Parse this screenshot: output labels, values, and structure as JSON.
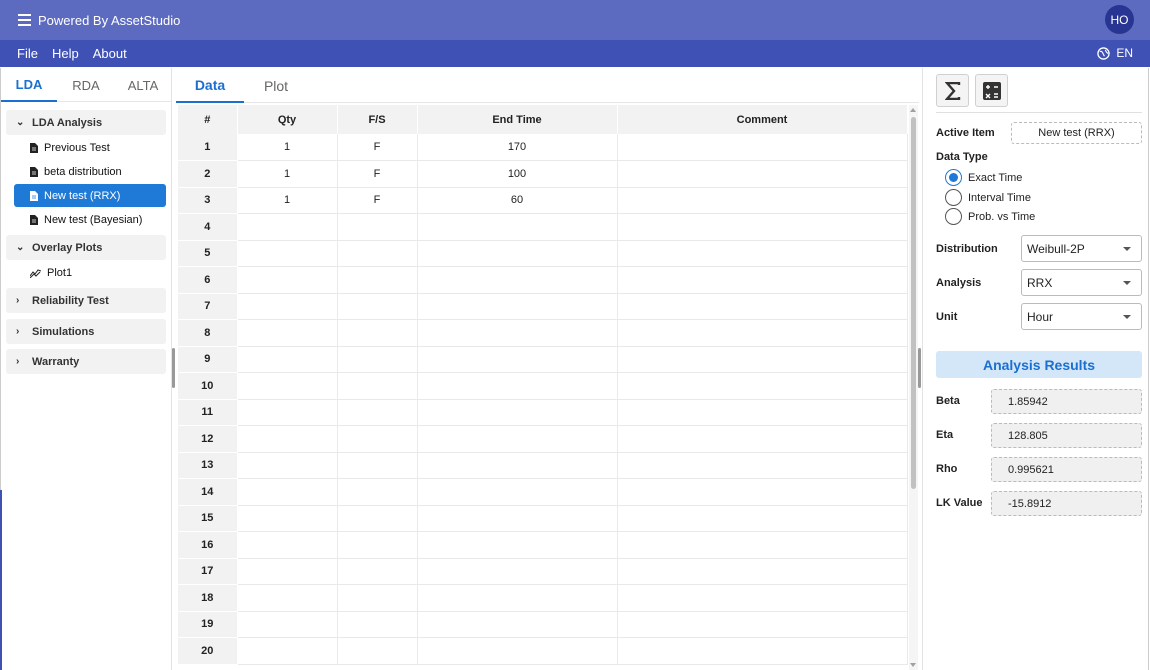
{
  "titlebar": {
    "title": "Powered By AssetStudio",
    "avatar": "HO"
  },
  "menu": {
    "file": "File",
    "help": "Help",
    "about": "About",
    "language": "EN"
  },
  "left_tabs": {
    "lda": "LDA",
    "rda": "RDA",
    "alta": "ALTA"
  },
  "tree": {
    "lda_analysis": "LDA Analysis",
    "items": [
      "Previous Test",
      "beta distribution",
      "New test (RRX)",
      "New test (Bayesian)"
    ],
    "overlay_plots": "Overlay Plots",
    "plot1": "Plot1",
    "reliability_test": "Reliability Test",
    "simulations": "Simulations",
    "warranty": "Warranty"
  },
  "center_tabs": {
    "data": "Data",
    "plot": "Plot"
  },
  "table": {
    "headers": [
      "#",
      "Qty",
      "F/S",
      "End Time",
      "Comment"
    ],
    "rows": [
      [
        "1",
        "1",
        "F",
        "170",
        ""
      ],
      [
        "2",
        "1",
        "F",
        "100",
        ""
      ],
      [
        "3",
        "1",
        "F",
        "60",
        ""
      ],
      [
        "4",
        "",
        "",
        "",
        ""
      ],
      [
        "5",
        "",
        "",
        "",
        ""
      ],
      [
        "6",
        "",
        "",
        "",
        ""
      ],
      [
        "7",
        "",
        "",
        "",
        ""
      ],
      [
        "8",
        "",
        "",
        "",
        ""
      ],
      [
        "9",
        "",
        "",
        "",
        ""
      ],
      [
        "10",
        "",
        "",
        "",
        ""
      ],
      [
        "11",
        "",
        "",
        "",
        ""
      ],
      [
        "12",
        "",
        "",
        "",
        ""
      ],
      [
        "13",
        "",
        "",
        "",
        ""
      ],
      [
        "14",
        "",
        "",
        "",
        ""
      ],
      [
        "15",
        "",
        "",
        "",
        ""
      ],
      [
        "16",
        "",
        "",
        "",
        ""
      ],
      [
        "17",
        "",
        "",
        "",
        ""
      ],
      [
        "18",
        "",
        "",
        "",
        ""
      ],
      [
        "19",
        "",
        "",
        "",
        ""
      ],
      [
        "20",
        "",
        "",
        "",
        ""
      ]
    ]
  },
  "right": {
    "active_item_label": "Active Item",
    "active_item_value": "New test (RRX)",
    "data_type_label": "Data Type",
    "data_types": [
      "Exact Time",
      "Interval Time",
      "Prob. vs Time"
    ],
    "selected_data_type": "Exact Time",
    "distribution_label": "Distribution",
    "distribution_value": "Weibull-2P",
    "analysis_label": "Analysis",
    "analysis_value": "RRX",
    "unit_label": "Unit",
    "unit_value": "Hour",
    "results_title": "Analysis Results",
    "results": [
      {
        "label": "Beta",
        "value": "1.85942"
      },
      {
        "label": "Eta",
        "value": "128.805"
      },
      {
        "label": "Rho",
        "value": "0.995621"
      },
      {
        "label": "LK Value",
        "value": "-15.8912"
      }
    ]
  },
  "colors": {
    "titlebar": "#5c6bc0",
    "menubar": "#3f51b5",
    "accent": "#1a6fd1",
    "selected": "#1e7ad6",
    "results_bg": "#d4e7f8"
  },
  "icons": {
    "menu": "hamburger-icon",
    "globe": "globe-icon",
    "sum": "sigma-icon",
    "calc": "calculator-icon",
    "doc": "document-icon",
    "plot": "chart-line-icon"
  }
}
